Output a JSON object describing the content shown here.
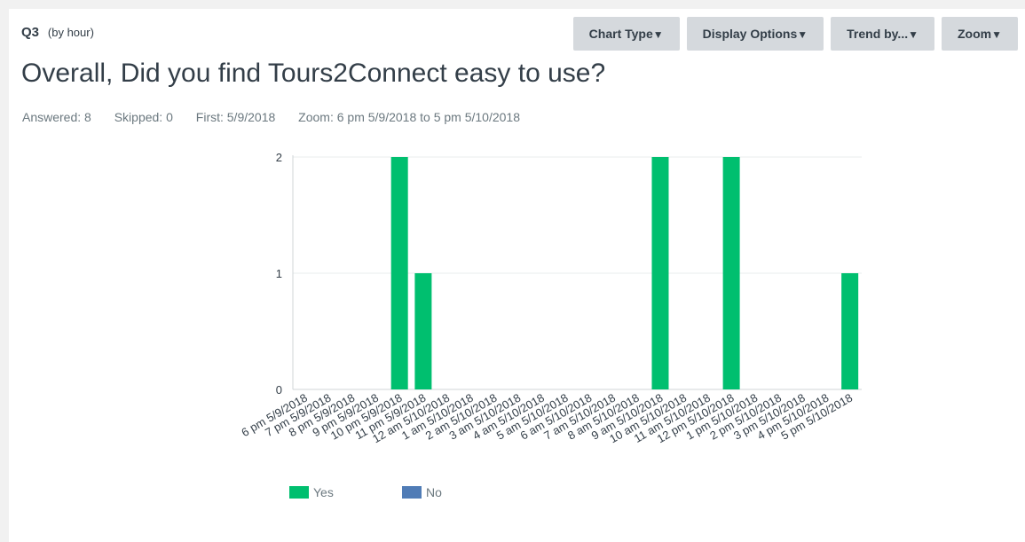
{
  "question": {
    "number": "Q3",
    "granularity": "(by hour)",
    "title": "Overall, Did you find Tours2Connect easy to use?"
  },
  "toolbar": {
    "chart_type": "Chart Type",
    "display_options": "Display Options",
    "trend_by": "Trend by...",
    "zoom": "Zoom"
  },
  "stats": {
    "answered": "Answered: 8",
    "skipped": "Skipped: 0",
    "first": "First: 5/9/2018",
    "zoom": "Zoom: 6 pm 5/9/2018 to 5 pm 5/10/2018"
  },
  "colors": {
    "yes": "#00bf6f",
    "no": "#507cb6",
    "axis": "#d0d4d7",
    "grid": "#eaecee"
  },
  "chart_data": {
    "type": "bar",
    "categories": [
      "6 pm 5/9/2018",
      "7 pm 5/9/2018",
      "8 pm 5/9/2018",
      "9 pm 5/9/2018",
      "10 pm 5/9/2018",
      "11 pm 5/9/2018",
      "12 am 5/10/2018",
      "1 am 5/10/2018",
      "2 am 5/10/2018",
      "3 am 5/10/2018",
      "4 am 5/10/2018",
      "5 am 5/10/2018",
      "6 am 5/10/2018",
      "7 am 5/10/2018",
      "8 am 5/10/2018",
      "9 am 5/10/2018",
      "10 am 5/10/2018",
      "11 am 5/10/2018",
      "12 pm 5/10/2018",
      "1 pm 5/10/2018",
      "2 pm 5/10/2018",
      "3 pm 5/10/2018",
      "4 pm 5/10/2018",
      "5 pm 5/10/2018"
    ],
    "series": [
      {
        "name": "Yes",
        "values": [
          0,
          0,
          0,
          0,
          2,
          1,
          0,
          0,
          0,
          0,
          0,
          0,
          0,
          0,
          0,
          2,
          0,
          0,
          2,
          0,
          0,
          0,
          0,
          1
        ]
      },
      {
        "name": "No",
        "values": [
          0,
          0,
          0,
          0,
          0,
          0,
          0,
          0,
          0,
          0,
          0,
          0,
          0,
          0,
          0,
          0,
          0,
          0,
          0,
          0,
          0,
          0,
          0,
          0
        ]
      }
    ],
    "yticks": [
      0,
      1,
      2
    ],
    "ylim": [
      0,
      2
    ],
    "legend_position": "bottom-left",
    "grid": true
  }
}
